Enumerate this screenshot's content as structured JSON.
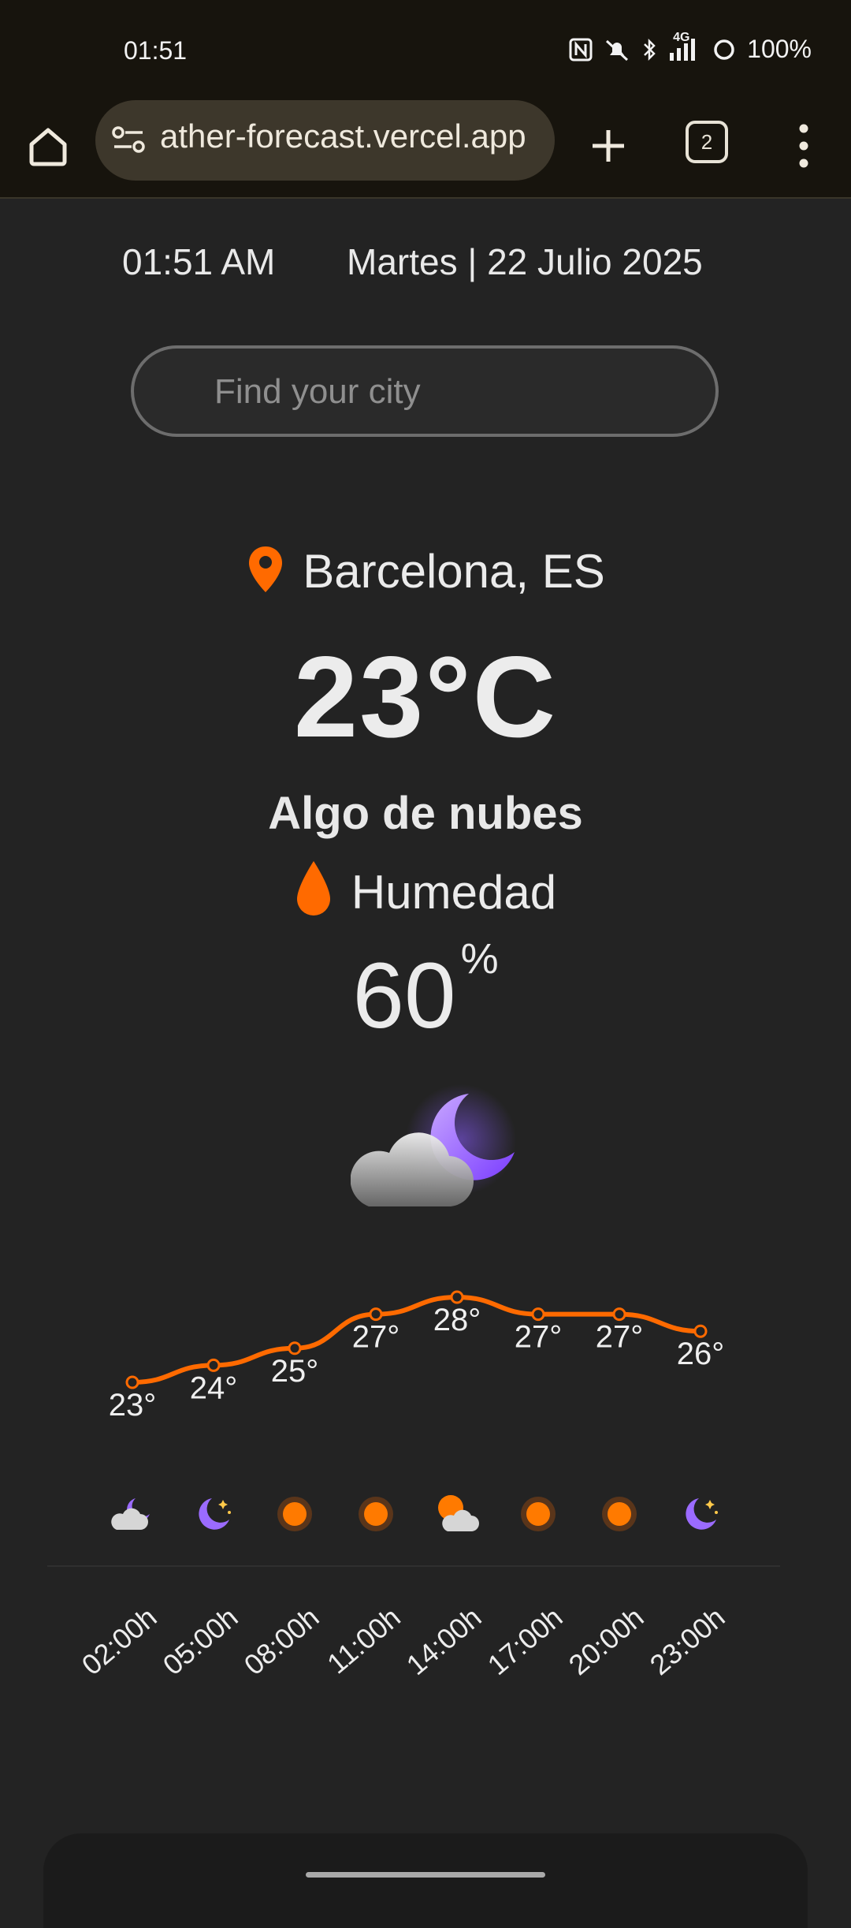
{
  "status_bar": {
    "time": "01:51",
    "network": "4G",
    "battery": "100%"
  },
  "browser": {
    "url": "ather-forecast.vercel.app",
    "tab_count": "2"
  },
  "header": {
    "time": "01:51 AM",
    "date": "Martes | 22 Julio 2025"
  },
  "search": {
    "placeholder": "Find your city"
  },
  "weather": {
    "city": "Barcelona, ES",
    "temperature": "23°C",
    "description": "Algo de nubes",
    "humidity_label": "Humedad",
    "humidity_value": "60",
    "humidity_unit": "%",
    "icon": "cloud-moon-icon"
  },
  "colors": {
    "accent": "#ff6a00",
    "background": "#232323",
    "moon": "#9b6bff"
  },
  "chart_data": {
    "type": "line",
    "categories": [
      "02:00h",
      "05:00h",
      "08:00h",
      "11:00h",
      "14:00h",
      "17:00h",
      "20:00h",
      "23:00h"
    ],
    "values": [
      23,
      24,
      25,
      27,
      28,
      27,
      27,
      26
    ],
    "labels": [
      "23°",
      "24°",
      "25°",
      "27°",
      "28°",
      "27°",
      "27°",
      "26°"
    ],
    "icons": [
      "cloud-moon-icon",
      "moon-stars-icon",
      "sun-icon",
      "sun-icon",
      "sun-cloud-icon",
      "sun-icon",
      "sun-icon",
      "moon-stars-icon"
    ],
    "unit": "°C",
    "color": "#ff6a00"
  }
}
